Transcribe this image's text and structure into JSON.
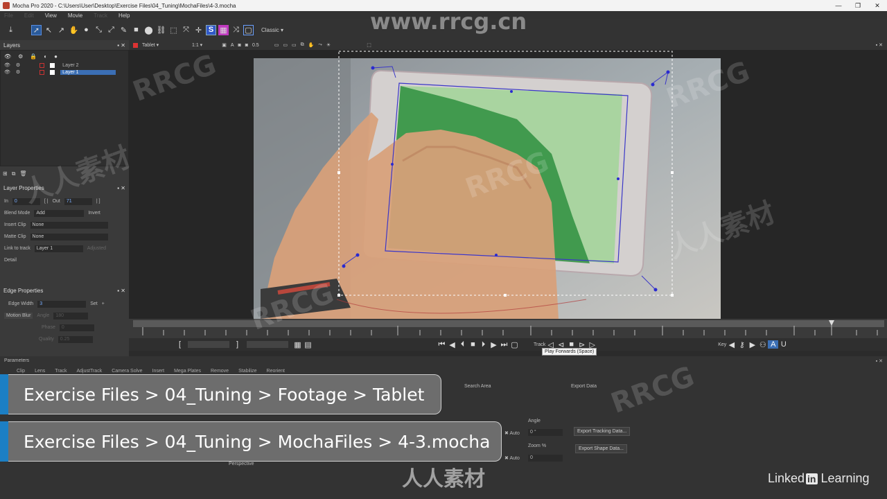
{
  "window": {
    "title": "Mocha Pro 2020 - C:\\Users\\User\\Desktop\\Exercise Files\\04_Tuning\\MochaFiles\\4-3.mocha"
  },
  "menu": {
    "items": [
      "File",
      "Edit",
      "View",
      "Movie",
      "Track",
      "Help"
    ]
  },
  "toolbar": {
    "workspace": "Classic"
  },
  "layers_panel": {
    "title": "Layers",
    "layers": [
      {
        "name": "Layer 2",
        "selected": false
      },
      {
        "name": "Layer 1",
        "selected": true
      }
    ]
  },
  "layer_properties": {
    "title": "Layer Properties",
    "in_label": "In",
    "in_value": "0",
    "out_label": "Out",
    "out_value": "71",
    "blend_mode_label": "Blend Mode",
    "blend_mode_value": "Add",
    "invert_label": "Invert",
    "insert_clip_label": "Insert Clip",
    "insert_clip_value": "None",
    "matte_clip_label": "Matte Clip",
    "matte_clip_value": "None",
    "link_to_track_label": "Link to track",
    "link_to_track_value": "Layer 1",
    "advanced_label": "Adjusted",
    "detail_label": "Detail"
  },
  "edge_properties": {
    "title": "Edge Properties",
    "edge_width_label": "Edge Width",
    "edge_width_value": "3",
    "set_label": "Set",
    "motion_blur_label": "Motion Blur",
    "angle_label": "Angle",
    "angle_value": "180",
    "phase_label": "Phase",
    "phase_value": "0",
    "quality_label": "Quality",
    "quality_value": "0.25"
  },
  "viewer": {
    "clip_name": "Tablet",
    "zoom": "1:1",
    "opacity": "0.5"
  },
  "transport": {
    "track_label": "Track",
    "key_label": "Key",
    "tooltip": "Play Forwards (Space)"
  },
  "parameters": {
    "title": "Parameters",
    "tabs": [
      "Clip",
      "Lens",
      "Track",
      "AdjustTrack",
      "Camera Solve",
      "Insert",
      "Mega Plates",
      "Remove",
      "Stabilize",
      "Reorient"
    ],
    "search_area_label": "Search Area",
    "export_data_label": "Export Data",
    "angle_label": "Angle",
    "angle_value": "0 °",
    "zoom_label": "Zoom %",
    "zoom_value": "0",
    "auto_label": "Auto",
    "perspective_label": "Perspective",
    "export_tracking_label": "Export Tracking Data...",
    "export_shape_label": "Export Shape Data..."
  },
  "banners": [
    {
      "text": "Exercise Files > 04_Tuning > Footage > Tablet"
    },
    {
      "text": "Exercise Files > 04_Tuning > MochaFiles > 4-3.mocha"
    }
  ],
  "watermarks": {
    "url": "www.rrcg.cn",
    "brand": "RRCG",
    "cn": "人人素材"
  },
  "branding": {
    "linkedin_prefix": "Linked",
    "linkedin_in": "in",
    "linkedin_suffix": "Learning"
  },
  "colors": {
    "accent": "#3b6fb5",
    "banner_bar": "#1c7fc4",
    "tablet_screen": "#8fc28a",
    "tablet_green": "#2a8a3a"
  }
}
